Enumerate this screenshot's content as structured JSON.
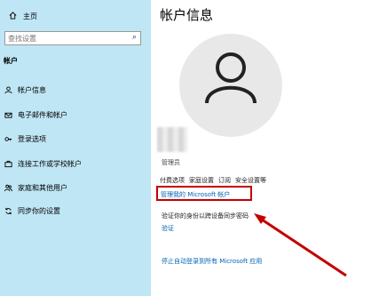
{
  "sidebar": {
    "home_label": "主页",
    "search_placeholder": "查找设置",
    "section_title": "帐户",
    "items": [
      {
        "label": "帐户信息",
        "icon": "person-icon"
      },
      {
        "label": "电子邮件和帐户",
        "icon": "mail-icon"
      },
      {
        "label": "登录选项",
        "icon": "key-icon"
      },
      {
        "label": "连接工作或学校帐户",
        "icon": "briefcase-icon"
      },
      {
        "label": "家庭和其他用户",
        "icon": "people-icon"
      },
      {
        "label": "同步你的设置",
        "icon": "sync-icon"
      }
    ]
  },
  "main": {
    "title": "帐户信息",
    "role": "管理员",
    "links": [
      "付费选项",
      "家庭设置",
      "订阅",
      "安全设置等"
    ],
    "manage_link": "管理我的 Microsoft 帐户",
    "verify_text": "验证你的身份以跨设备同步密码",
    "verify_link": "验证",
    "stop_link": "停止自动登录到所有 Microsoft 应用"
  },
  "colors": {
    "sidebar_bg": "#bfe6f5",
    "link": "#0063b1",
    "highlight": "#c40000"
  }
}
